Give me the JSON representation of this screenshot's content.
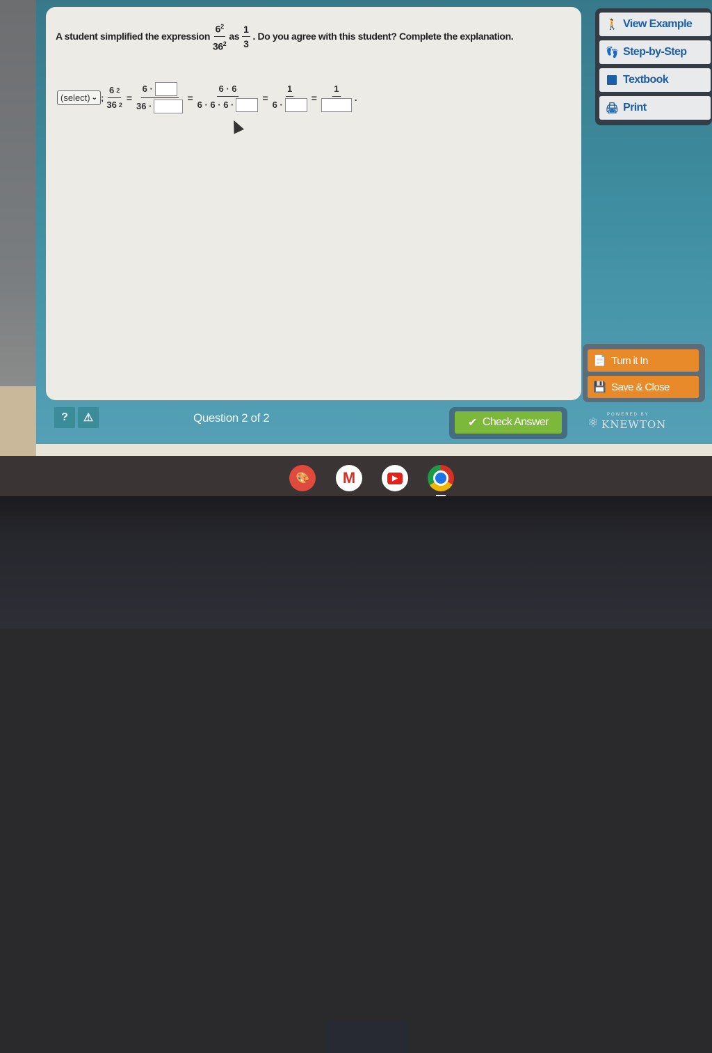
{
  "question": {
    "prompt_before": "A student simplified the expression",
    "expr_num_base": "6",
    "expr_num_exp": "2",
    "expr_den_base": "36",
    "expr_den_exp": "2",
    "as_word": "as",
    "result_num": "1",
    "result_den": "3",
    "prompt_after": ". Do you agree with this student? Complete the explanation."
  },
  "work": {
    "select_label": "(select)",
    "semicolon": ";",
    "step1_num_base": "6",
    "step1_num_exp": "2",
    "step1_den_base": "36",
    "step1_den_exp": "2",
    "step2_num": "6 ·",
    "step2_den": "36 ·",
    "step3_num": "6 · 6",
    "step3_den": "6 · 6 · 6 ·",
    "step4_num": "1",
    "step4_den": "6 ·",
    "step5_num": "1",
    "equals": "=",
    "period": "."
  },
  "sidebar": {
    "items": [
      {
        "label": "View Example",
        "icon": "presenter-icon"
      },
      {
        "label": "Step-by-Step",
        "icon": "footprint-icon"
      },
      {
        "label": "Textbook",
        "icon": "book-icon"
      },
      {
        "label": "Print",
        "icon": "printer-icon"
      }
    ]
  },
  "actions": {
    "turn_in": "Turn it In",
    "save_close": "Save & Close"
  },
  "footer": {
    "help_icon": "?",
    "warning_icon": "⚠",
    "question_counter": "Question 2 of 2",
    "check_answer": "Check Answer",
    "powered_by": "POWERED BY",
    "brand": "KNEWTON"
  },
  "shelf": {
    "apps": [
      "Canvas",
      "Gmail",
      "YouTube",
      "Chrome"
    ]
  },
  "colors": {
    "accent_blue": "#1d5fa6",
    "orange": "#e88a2a",
    "green": "#7cb83a",
    "teal": "#3f8da0"
  }
}
